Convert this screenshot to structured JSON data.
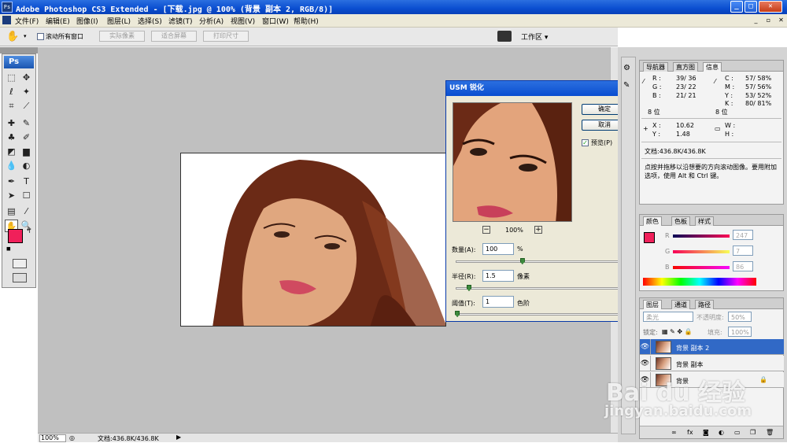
{
  "window": {
    "title": "Adobe Photoshop CS3 Extended - [下载.jpg @ 100% (背景 副本 2, RGB/8)]",
    "app_icon": "Ps",
    "minimize": "_",
    "maximize": "□",
    "close": "✕",
    "doc_min": "_",
    "doc_max": "▫",
    "doc_close": "✕"
  },
  "menu": [
    "文件(F)",
    "编辑(E)",
    "图像(I)",
    "图层(L)",
    "选择(S)",
    "滤镜(T)",
    "分析(A)",
    "视图(V)",
    "窗口(W)",
    "帮助(H)"
  ],
  "options_bar": {
    "scroll_all_label": "滚动所有窗口",
    "actual_pixels": "实际像素",
    "fit_screen": "适合屏幕",
    "print_size": "打印尺寸",
    "workspace": "工作区 ▾"
  },
  "toolbox": {
    "logo": "Ps",
    "foreground_color": "#f0205a",
    "background_color": "#ffffff"
  },
  "status": {
    "zoom": "100%",
    "doc_info": "文档:436.8K/436.8K"
  },
  "usm_dialog": {
    "title": "USM 锐化",
    "ok": "确定",
    "cancel": "取消",
    "preview_label": "预览(P)",
    "zoom": "100%",
    "zoom_out": "−",
    "zoom_in": "+",
    "amount_label": "数量(A):",
    "amount_value": "100",
    "amount_unit": "%",
    "amount_slider": 0.4,
    "radius_label": "半径(R):",
    "radius_value": "1.5",
    "radius_unit": "像素",
    "radius_slider": 0.08,
    "threshold_label": "阈值(T):",
    "threshold_value": "1",
    "threshold_unit": "色阶",
    "threshold_slider": 0.01
  },
  "info_panel": {
    "tabs": [
      "导航器",
      "直方图",
      "信息"
    ],
    "r_label": "R :",
    "r_value": "39/  36",
    "g_label": "G :",
    "g_value": "23/  22",
    "b_label": "B :",
    "b_value": "21/  21",
    "bits_left": "8 位",
    "c_label": "C :",
    "c_value": "57/  58%",
    "m_label": "M :",
    "m_value": "57/  56%",
    "y_label": "Y :",
    "y_value": "53/  52%",
    "k_label": "K :",
    "k_value": "80/  81%",
    "bits_right": "8 位",
    "x_label": "X :",
    "x_value": "10.62",
    "y2_label": "Y :",
    "y2_value": "1.48",
    "w_label": "W :",
    "h_label": "H :",
    "doc": "文档:436.8K/436.8K",
    "hint": "点按并拖移以沿想要的方向滚动图像。要用附加选项，使用 Alt 和 Ctrl 键。"
  },
  "color_panel": {
    "tabs": [
      "颜色",
      "色板",
      "样式"
    ],
    "r_label": "R",
    "r_value": "247",
    "g_label": "G",
    "g_value": "7",
    "b_label": "B",
    "b_value": "86"
  },
  "layers_panel": {
    "tabs": [
      "图层",
      "通道",
      "路径"
    ],
    "blend_mode": "柔光",
    "opacity_label": "不透明度:",
    "opacity_value": "50%",
    "lock_label": "锁定:",
    "fill_label": "填充:",
    "fill_value": "100%",
    "layers": [
      {
        "name": "背景 副本 2",
        "selected": true
      },
      {
        "name": "背景 副本",
        "selected": false
      },
      {
        "name": "背景",
        "selected": false
      }
    ]
  },
  "watermark": {
    "brand": "Bai du 经验",
    "url": "jingyan.baidu.com"
  }
}
